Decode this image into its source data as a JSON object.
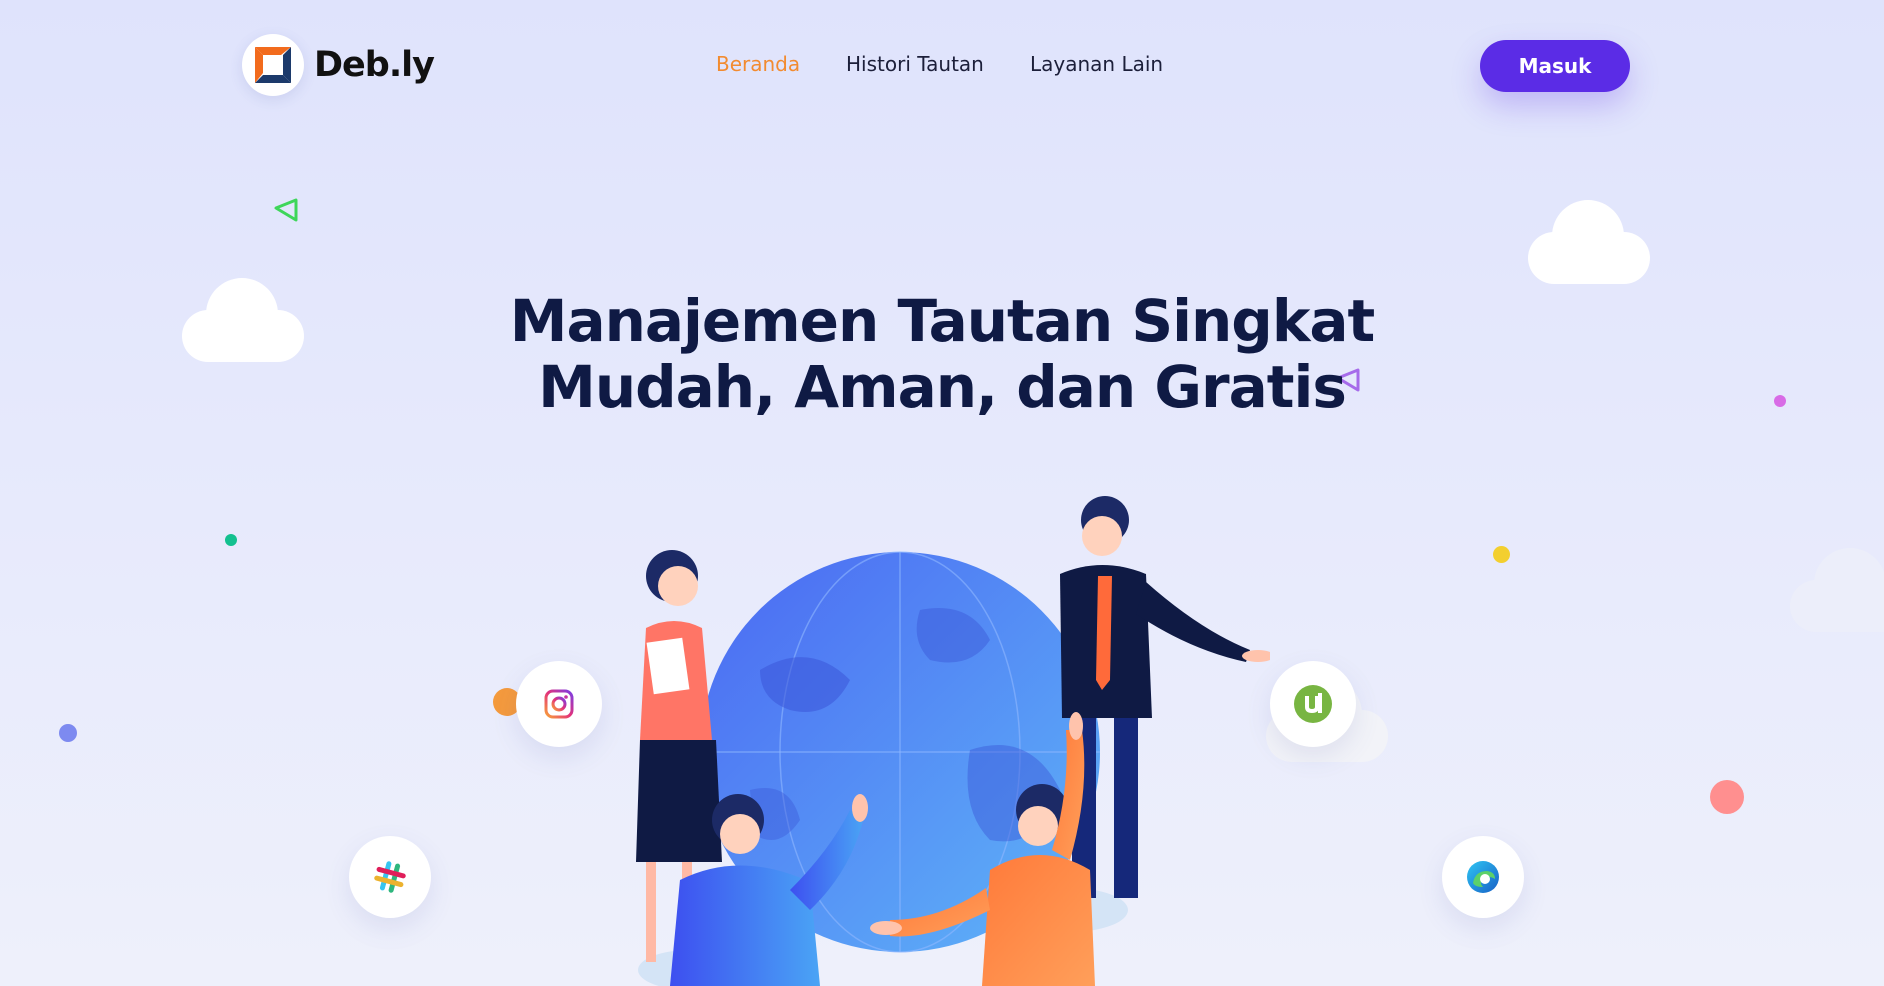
{
  "brand": {
    "name": "Deb.ly",
    "logo_icon": "debly-logo-icon"
  },
  "nav": {
    "items": [
      {
        "label": "Beranda",
        "active": true
      },
      {
        "label": "Histori Tautan",
        "active": false
      },
      {
        "label": "Layanan Lain",
        "active": false
      }
    ],
    "login_label": "Masuk"
  },
  "hero": {
    "title_line1": "Manajemen Tautan Singkat",
    "title_line2": "Mudah, Aman, dan Gratis"
  },
  "icons": {
    "instagram": "instagram-icon",
    "slack": "slack-icon",
    "utorrent": "utorrent-icon",
    "edge": "edge-icon"
  },
  "colors": {
    "accent": "#5b2ce6",
    "active_nav": "#f28b30",
    "title": "#0f1a44",
    "background": "#e2e6fc"
  }
}
